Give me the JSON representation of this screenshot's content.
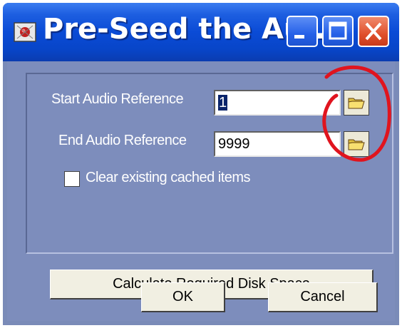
{
  "window": {
    "title": "Pre-Seed the Au...",
    "accent": "#0a4bd6",
    "body_color": "#7d8dbc"
  },
  "titlebar_buttons": [
    {
      "name": "minimize",
      "icon": "minimize-icon"
    },
    {
      "name": "maximize",
      "icon": "maximize-icon"
    },
    {
      "name": "close",
      "icon": "close-icon"
    }
  ],
  "form": {
    "start_label": "Start Audio Reference",
    "start_value": "1",
    "end_label": "End Audio Reference",
    "end_value": "9999",
    "browse_icon": "folder-icon",
    "clear_cache_label": "Clear existing cached items",
    "clear_cache_checked": false,
    "calc_label": "Calculate Required Disk Space"
  },
  "buttons": {
    "ok": "OK",
    "cancel": "Cancel"
  },
  "annotation": {
    "color": "#e0141e",
    "shape": "hand-drawn circle around browse buttons"
  }
}
